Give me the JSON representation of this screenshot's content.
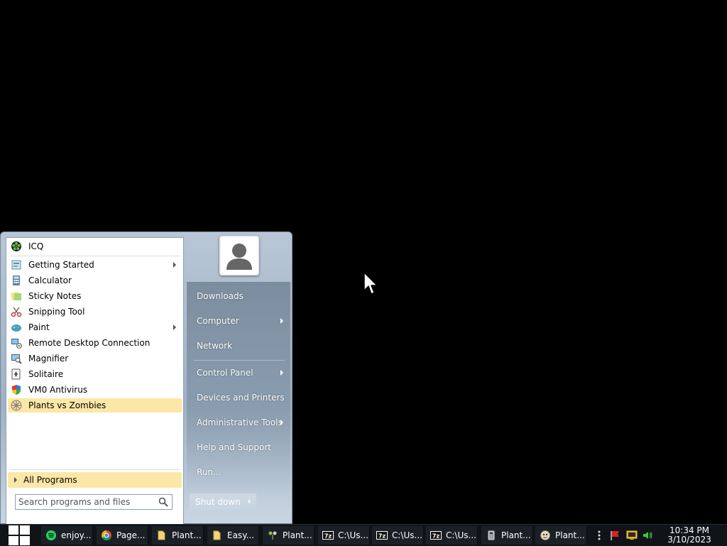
{
  "start_menu": {
    "programs": [
      {
        "label": "ICQ",
        "icon": "icq-icon",
        "submenu": false,
        "pinned": true
      },
      {
        "label": "Getting Started",
        "icon": "getting-started-icon",
        "submenu": true
      },
      {
        "label": "Calculator",
        "icon": "calculator-icon",
        "submenu": false
      },
      {
        "label": "Sticky Notes",
        "icon": "sticky-notes-icon",
        "submenu": false
      },
      {
        "label": "Snipping Tool",
        "icon": "scissors-icon",
        "submenu": false
      },
      {
        "label": "Paint",
        "icon": "paint-icon",
        "submenu": true
      },
      {
        "label": "Remote Desktop Connection",
        "icon": "remote-desktop-icon",
        "submenu": false
      },
      {
        "label": "Magnifier",
        "icon": "magnifier-icon",
        "submenu": false
      },
      {
        "label": "Solitaire",
        "icon": "solitaire-icon",
        "submenu": false
      },
      {
        "label": "VM0 Antivirus",
        "icon": "shield-icon",
        "submenu": false
      },
      {
        "label": "Plants vs Zombies",
        "icon": "plants-vs-zombies-icon",
        "submenu": false,
        "highlighted": true
      }
    ],
    "all_programs_label": "All Programs",
    "search": {
      "placeholder": "Search programs and files"
    },
    "right_links": [
      {
        "label": "Downloads",
        "submenu": false
      },
      {
        "label": "Computer",
        "submenu": true
      },
      {
        "label": "Network",
        "submenu": false
      },
      {
        "label": "Control Panel",
        "submenu": true
      },
      {
        "label": "Devices and Printers",
        "submenu": false
      },
      {
        "label": "Administrative Tools",
        "submenu": true
      },
      {
        "label": "Help and Support",
        "submenu": false
      },
      {
        "label": "Run...",
        "submenu": false
      }
    ],
    "shutdown_label": "Shut down"
  },
  "taskbar": {
    "tasks": [
      {
        "label": "enjoy...",
        "icon": "spotify-icon"
      },
      {
        "label": "Page...",
        "icon": "chrome-icon"
      },
      {
        "label": "Plant...",
        "icon": "folder-icon"
      },
      {
        "label": "Easy...",
        "icon": "folder-icon"
      },
      {
        "label": "Plant...",
        "icon": "plant-game-icon"
      },
      {
        "label": "C:\\Us...",
        "icon": "7zip-icon"
      },
      {
        "label": "C:\\Us...",
        "icon": "7zip-icon"
      },
      {
        "label": "C:\\Us...",
        "icon": "7zip-icon"
      },
      {
        "label": "Plant...",
        "icon": "application-icon"
      },
      {
        "label": "Plant...",
        "icon": "plants-vs-zombies-icon"
      }
    ],
    "clock": {
      "time": "10:34 PM",
      "date": "3/10/2023"
    }
  }
}
